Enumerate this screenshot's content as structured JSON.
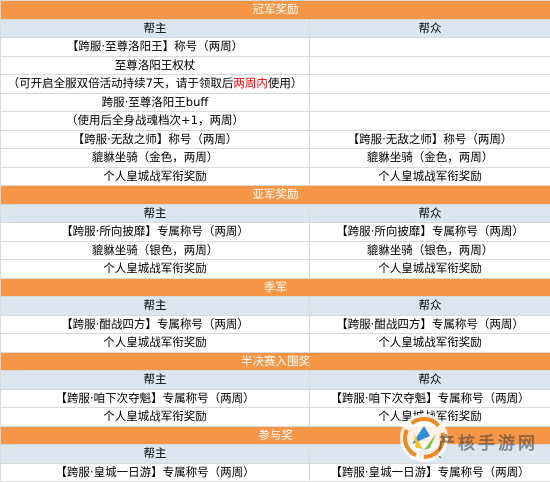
{
  "colors": {
    "section_bg": "#f79646",
    "header_bg": "#dce6f1",
    "highlight": "#ff0000"
  },
  "columns": {
    "leader": "帮主",
    "member": "帮众"
  },
  "sections": {
    "champion": {
      "title": "冠军奖励",
      "rows": [
        [
          "【跨服·至尊洛阳王】称号（两周）",
          ""
        ],
        [
          "至尊洛阳王权杖",
          ""
        ],
        [
          "跨服·至尊洛阳王buff",
          ""
        ],
        [
          "（使用后全身战魂档次+1，两周）",
          ""
        ],
        [
          "【跨服·无敌之师】称号（两周）",
          "【跨服·无敌之师】称号（两周）"
        ],
        [
          "貔貅坐骑（金色，两周）",
          "貔貅坐骑（金色，两周）"
        ],
        [
          "个人皇城战军衔奖励",
          "个人皇城战军衔奖励"
        ]
      ],
      "note": {
        "before": "（可开启全服双倍活动持续7天，请于领取后",
        "highlight": "两周内",
        "after": "使用）"
      }
    },
    "runner_up": {
      "title": "亚军奖励",
      "rows": [
        [
          "【跨服·所向披靡】专属称号（两周）",
          "【跨服·所向披靡】专属称号（两周）"
        ],
        [
          "貔貅坐骑（银色，两周）",
          "貔貅坐骑（银色，两周）"
        ],
        [
          "个人皇城战军衔奖励",
          "个人皇城战军衔奖励"
        ]
      ]
    },
    "third": {
      "title": "季军",
      "rows": [
        [
          "【跨服·酣战四方】专属称号（两周）",
          "【跨服·酣战四方】专属称号（两周）"
        ],
        [
          "个人皇城战军衔奖励",
          "个人皇城战军衔奖励"
        ]
      ]
    },
    "semifinal": {
      "title": "半决赛入围奖",
      "rows": [
        [
          "【跨服·咱下次夺魁】专属称号（两周）",
          "【跨服·咱下次夺魁】专属称号（两周）"
        ],
        [
          "个人皇城战军衔奖励",
          "个人皇城战军衔奖励"
        ]
      ]
    },
    "participation": {
      "title": "参与奖",
      "rows": [
        [
          "【跨服·皇城一日游】专属称号（两周）",
          "【跨服·皇城一日游】专属称号（两周）"
        ]
      ]
    }
  },
  "watermark": {
    "text": "产核手游网"
  }
}
